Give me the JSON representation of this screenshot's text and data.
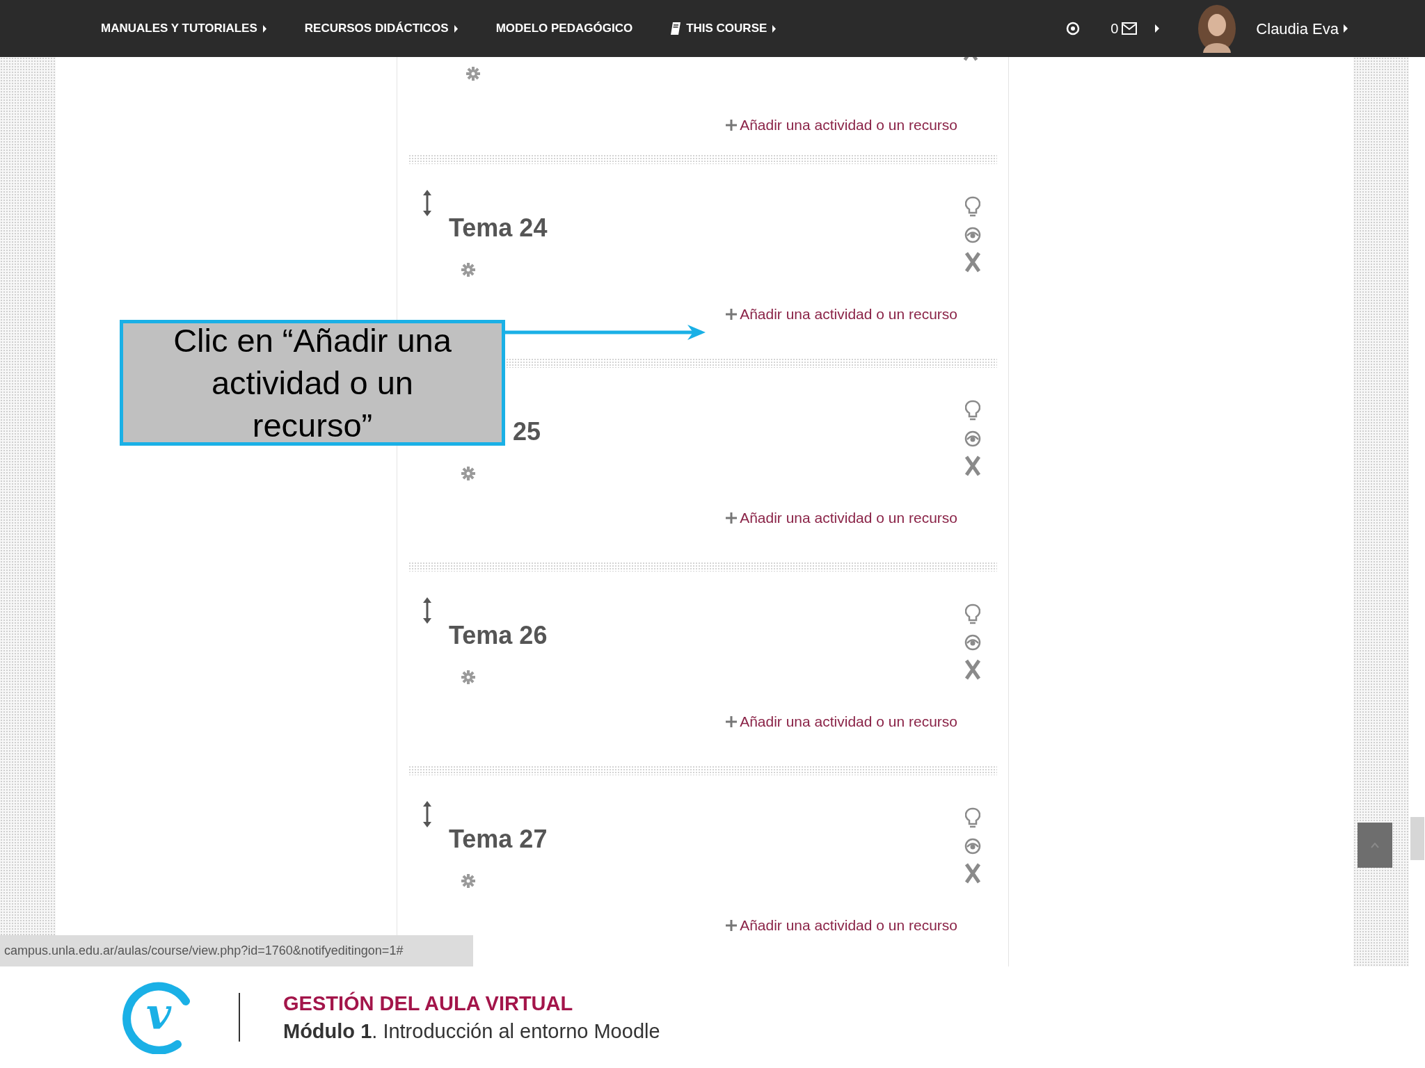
{
  "nav": {
    "items": [
      {
        "kind": "plain",
        "label": "MANUALES Y TUTORIALES",
        "caret": true
      },
      {
        "kind": "plain",
        "label": "RECURSOS DIDÁCTICOS",
        "caret": true
      },
      {
        "kind": "plain",
        "label": "MODELO PEDAGÓGICO",
        "caret": false
      },
      {
        "kind": "book",
        "label": "THIS COURSE",
        "caret": true
      }
    ],
    "message_count": "0",
    "user": "Claudia Eva"
  },
  "sections": [
    {
      "kind": "tail",
      "link": "Añadir una actividad o un recurso"
    },
    {
      "kind": "topic",
      "title": "Tema 24",
      "link": "Añadir una actividad o un recurso"
    },
    {
      "kind": "covered_topic",
      "title": "25",
      "link": "Añadir una actividad o un recurso"
    },
    {
      "kind": "topic",
      "title": "Tema 26",
      "link": "Añadir una actividad o un recurso"
    },
    {
      "kind": "topic",
      "title": "Tema 27",
      "link": "Añadir una actividad o un recurso"
    }
  ],
  "status_url": "campus.unla.edu.ar/aulas/course/view.php?id=1760&notifyeditingon=1#",
  "callout": "Clic en “Añadir una actividad o un recurso”",
  "footer": {
    "logo_letter": "v",
    "title": "GESTIÓN DEL AULA VIRTUAL",
    "subtitle": "**Módulo 1**. Introducción al entorno Moodle"
  }
}
